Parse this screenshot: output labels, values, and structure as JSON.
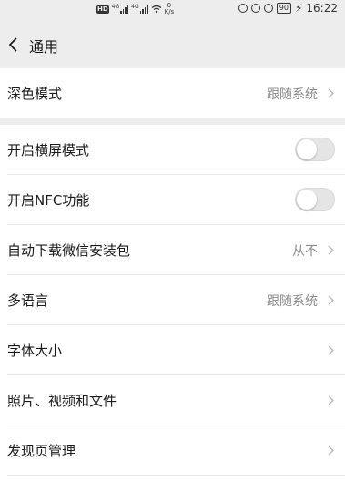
{
  "status_bar": {
    "speed_value": "0",
    "speed_unit": "K/s",
    "battery": "90",
    "time": "16:22",
    "network_tag": "4G",
    "hd_label": "HD"
  },
  "header": {
    "title": "通用"
  },
  "settings": {
    "dark_mode": {
      "label": "深色模式",
      "value": "跟随系统"
    },
    "landscape": {
      "label": "开启横屏模式",
      "enabled": false
    },
    "nfc": {
      "label": "开启NFC功能",
      "enabled": false
    },
    "auto_download": {
      "label": "自动下载微信安装包",
      "value": "从不"
    },
    "language": {
      "label": "多语言",
      "value": "跟随系统"
    },
    "font_size": {
      "label": "字体大小"
    },
    "media": {
      "label": "照片、视频和文件"
    },
    "discover": {
      "label": "发现页管理"
    }
  }
}
